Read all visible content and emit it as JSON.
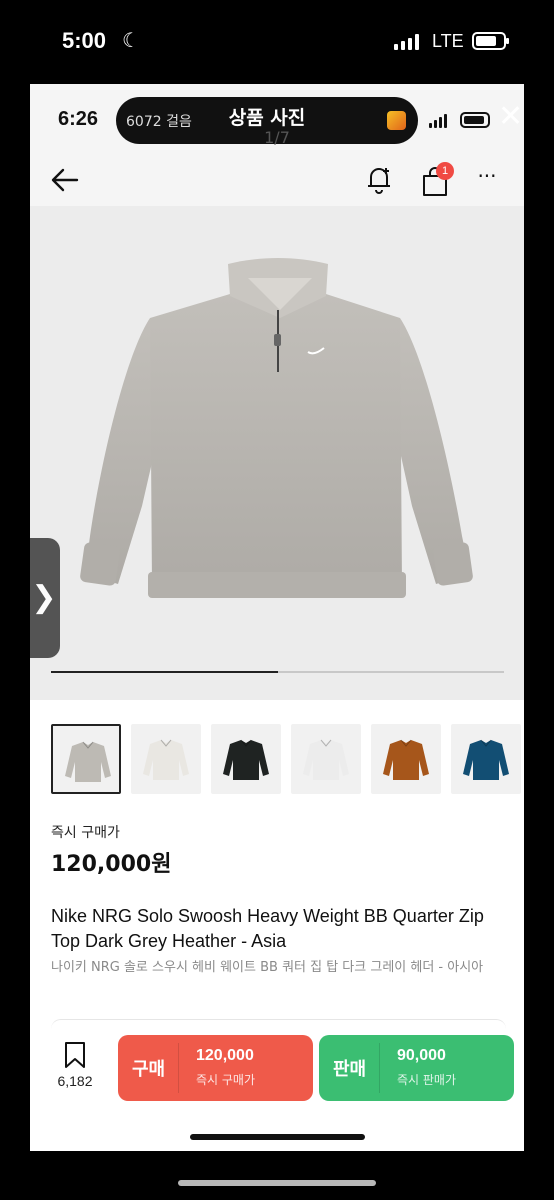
{
  "outer_status": {
    "time": "5:00",
    "network": "LTE"
  },
  "inner_status": {
    "time": "6:26",
    "steps": "6072 걸음"
  },
  "viewer": {
    "title": "상품 사진",
    "counter": "1/7"
  },
  "header": {
    "cart_badge": "1",
    "more": "···"
  },
  "gallery": {
    "progress": 0.5,
    "next_arrow": "❯"
  },
  "thumbnails": [
    {
      "color": "#bdbab4",
      "label": "grey"
    },
    {
      "color": "#e9e7e2",
      "label": "cream"
    },
    {
      "color": "#1f2322",
      "label": "black"
    },
    {
      "color": "#ececec",
      "label": "white"
    },
    {
      "color": "#a6561b",
      "label": "brown"
    },
    {
      "color": "#124e73",
      "label": "navy"
    }
  ],
  "product": {
    "price_label": "즉시 구매가",
    "price": "120,000원",
    "name_en": "Nike NRG Solo Swoosh Heavy Weight BB Quarter Zip Top Dark Grey Heather - Asia",
    "name_ko": "나이키 NRG 솔로 스우시 헤비 웨이트 BB 쿼터 집 탑 다크 그레이 헤더 - 아시아"
  },
  "actions": {
    "wish_count": "6,182",
    "buy": {
      "label": "구매",
      "price": "120,000",
      "sub": "즉시 구매가"
    },
    "sell": {
      "label": "판매",
      "price": "90,000",
      "sub": "즉시 판매가"
    }
  },
  "colors": {
    "buy": "#ef5a4a",
    "sell": "#3bbe72",
    "badge": "#f04a43"
  }
}
